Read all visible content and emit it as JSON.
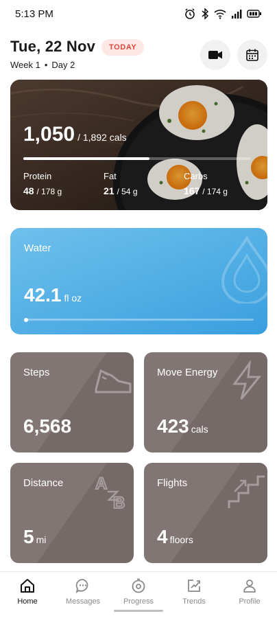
{
  "status_bar": {
    "time": "5:13 PM"
  },
  "header": {
    "date": "Tue, 22 Nov",
    "badge": "TODAY",
    "week": "Week 1",
    "day": "Day 2",
    "video_button_icon": "video-camera-icon",
    "calendar_button_icon": "calendar-icon"
  },
  "nutrition": {
    "calories_eaten": "1,050",
    "calories_target": "/ 1,892 cals",
    "progress_fraction": 0.555,
    "macros": [
      {
        "label": "Protein",
        "value": "48",
        "target": "/ 178 g"
      },
      {
        "label": "Fat",
        "value": "21",
        "target": "/ 54 g"
      },
      {
        "label": "Carbs",
        "value": "167",
        "target": "/ 174 g"
      }
    ]
  },
  "water": {
    "title": "Water",
    "value": "42.1",
    "unit": "fl oz",
    "progress_fraction": 0.0,
    "icon": "water-drop-icon"
  },
  "stats": [
    {
      "title": "Steps",
      "value": "6,568",
      "unit": "",
      "icon": "shoe-icon"
    },
    {
      "title": "Move Energy",
      "value": "423",
      "unit": "cals",
      "icon": "lightning-icon"
    },
    {
      "title": "Distance",
      "value": "5",
      "unit": "mi",
      "icon": "a-to-b-icon"
    },
    {
      "title": "Flights",
      "value": "4",
      "unit": "floors",
      "icon": "stairs-icon"
    }
  ],
  "tabs": [
    {
      "label": "Home",
      "icon": "home-icon",
      "active": true
    },
    {
      "label": "Messages",
      "icon": "chat-icon",
      "active": false
    },
    {
      "label": "Progress",
      "icon": "progress-icon",
      "active": false
    },
    {
      "label": "Trends",
      "icon": "trends-icon",
      "active": false
    },
    {
      "label": "Profile",
      "icon": "person-icon",
      "active": false
    }
  ],
  "colors": {
    "badge_bg": "#fde8e6",
    "badge_text": "#e0463a",
    "water_card": "#48a8e3",
    "stat_card": "#7a6e6b"
  }
}
